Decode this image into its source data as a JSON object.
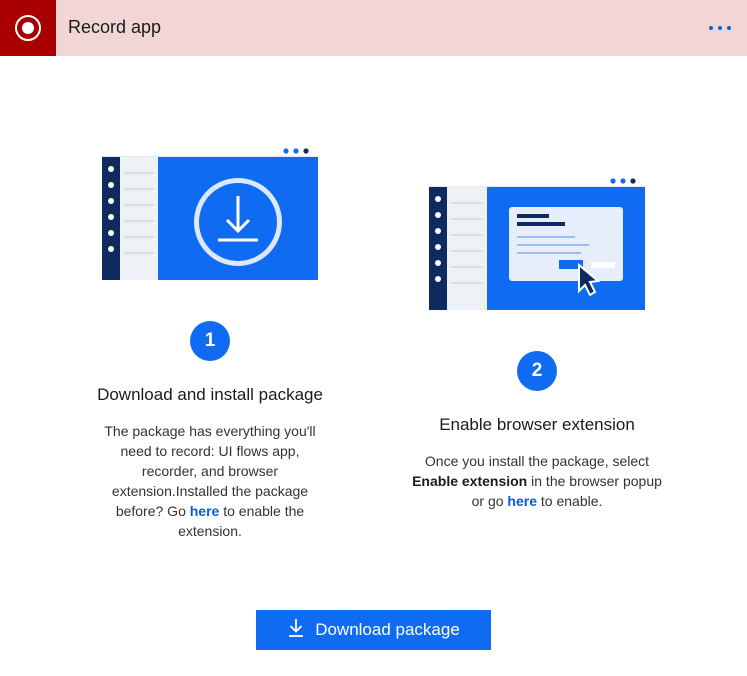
{
  "header": {
    "title": "Record app",
    "record_icon": "record-icon",
    "more_icon": "more-options-icon"
  },
  "steps": [
    {
      "number": "1",
      "title": "Download and install package",
      "description_before": "The package has everything you'll need to record: UI flows app, recorder, and browser extension.Installed the package before? Go ",
      "link_text": "here",
      "description_after": " to enable the extension.",
      "illustration": "download-illustration"
    },
    {
      "number": "2",
      "title": "Enable browser extension",
      "description_before": "Once you install the package, select ",
      "bold_text": "Enable extension",
      "description_middle": " in the browser popup or go ",
      "link_text": "here",
      "description_after": " to enable.",
      "illustration": "browser-extension-illustration"
    }
  ],
  "download_button": {
    "label": "Download package",
    "icon": "download-icon"
  },
  "colors": {
    "accent": "#0f6cf2",
    "header_bg": "#f2d6d6",
    "record_tile": "#a80000",
    "sidebar_navy": "#0e2a5e"
  }
}
